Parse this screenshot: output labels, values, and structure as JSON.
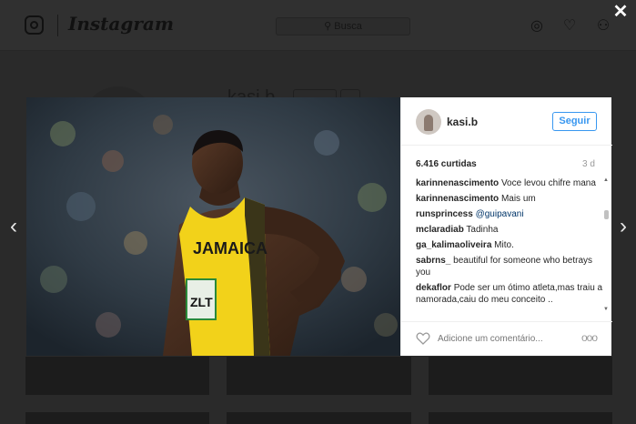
{
  "background": {
    "logo_text": "Instagram",
    "search_placeholder": "Busca",
    "profile_name": "kasi.b",
    "icons": [
      "compass-icon",
      "heart-icon",
      "user-icon"
    ]
  },
  "overlay": {
    "close_glyph": "✕",
    "prev_glyph": "‹",
    "next_glyph": "›"
  },
  "post": {
    "username": "kasi.b",
    "follow_label": "Seguir",
    "likes": "6.416 curtidas",
    "age": "3 d",
    "photo_bib_text": "ZLT",
    "photo_jersey_text": "JAMAICA",
    "comments": [
      {
        "user": "karinnenascimento",
        "text": "Voce levou chifre mana"
      },
      {
        "user": "karinnenascimento",
        "text": "Mais um"
      },
      {
        "user": "runsprincess",
        "text": "@guipavani"
      },
      {
        "user": "mclaradiab",
        "text": "Tadinha"
      },
      {
        "user": "ga_kalimaoliveira",
        "text": "Mito."
      },
      {
        "user": "sabrns_",
        "text": "beautiful for someone who betrays you"
      },
      {
        "user": "dekaflor",
        "text": "Pode ser um ótimo atleta,mas traiu a namorada,caiu do meu conceito .."
      }
    ],
    "add_comment_placeholder": "Adicione um comentário...",
    "more_glyph": "ooo"
  },
  "colors": {
    "accent": "#3897f0",
    "text": "#262626",
    "muted": "#999999"
  }
}
